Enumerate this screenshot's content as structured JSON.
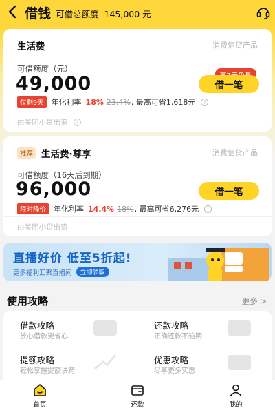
{
  "header": {
    "title": "借钱",
    "quota_label": "可借总额度",
    "quota_value": "145,000 元"
  },
  "cards": [
    {
      "title": "生活费",
      "recommend_tag": "",
      "product_tag": "消费信贷产品",
      "amount_label": "可借额度（元）",
      "amount": "49,000",
      "promo_bubble": "享7天免息",
      "button": "借一笔",
      "rate_tag": "仅剩9天",
      "rate_label": "年化利率",
      "rate_now": "18%",
      "rate_old": "23.4%",
      "rate_tail": ", 最高可省1,618元",
      "footer": "由美团小贷出资"
    },
    {
      "title": "生活费·尊享",
      "recommend_tag": "推荐",
      "product_tag": "消费信贷产品",
      "amount_label": "可借额度（16天后到期）",
      "amount": "96,000",
      "promo_bubble": "",
      "button": "借一笔",
      "rate_tag": "限时降价",
      "rate_label": "年化利率",
      "rate_now": "14.4%",
      "rate_old": "18%",
      "rate_tail": ", 最高可省6,276元",
      "footer": "由美团小贷出资"
    }
  ],
  "banner": {
    "title": "直播好价 低至5折起!",
    "subtitle": "更多福利汇聚直播间",
    "button": "立即领取"
  },
  "guide": {
    "title": "使用攻略",
    "more": "更多 >",
    "items": [
      {
        "title": "借款攻略",
        "subtitle": "放心借款更省心"
      },
      {
        "title": "还款攻略",
        "subtitle": "正确还款不逾期"
      },
      {
        "title": "提额攻略",
        "subtitle": "轻松掌握提额诀窍"
      },
      {
        "title": "优惠攻略",
        "subtitle": "尽享更多实惠"
      }
    ]
  },
  "tabs": [
    {
      "label": "首页",
      "icon": "home-icon",
      "active": true
    },
    {
      "label": "还款",
      "icon": "wallet-icon",
      "active": false
    },
    {
      "label": "我的",
      "icon": "user-icon",
      "active": false
    }
  ],
  "colors": {
    "brand_yellow": "#ffd426",
    "accent_red": "#e8432f",
    "banner_blue": "#1566c8"
  }
}
